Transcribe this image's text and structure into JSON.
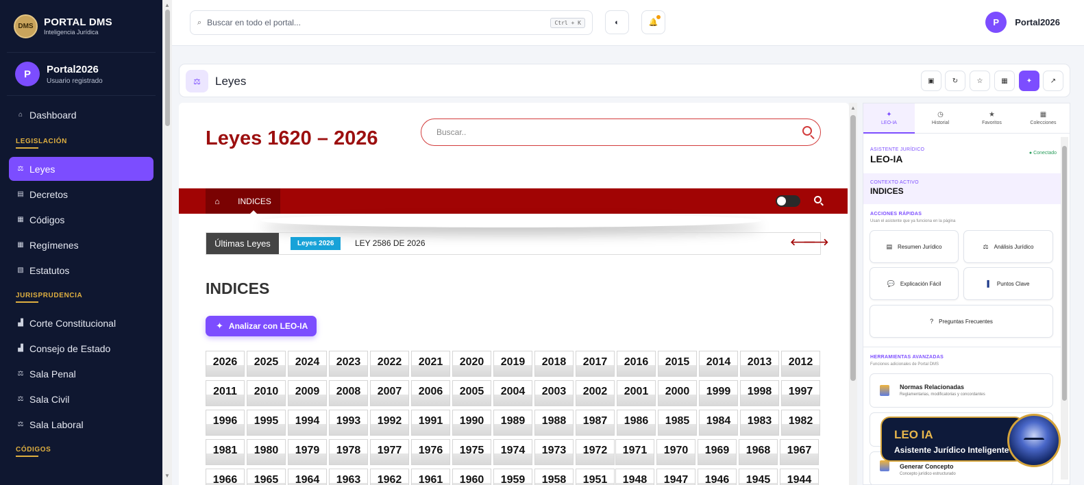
{
  "brand": {
    "logo": "DMS",
    "title": "PORTAL DMS",
    "subtitle": "Inteligencia Jurídica"
  },
  "user": {
    "initial": "P",
    "name": "Portal2026",
    "role": "Usuario registrado"
  },
  "sidebar": {
    "dashboard": "Dashboard",
    "sections": [
      {
        "title": "LEGISLACIÓN",
        "items": [
          "Leyes",
          "Decretos",
          "Códigos",
          "Regímenes",
          "Estatutos"
        ]
      },
      {
        "title": "JURISPRUDENCIA",
        "items": [
          "Corte Constitucional",
          "Consejo de Estado",
          "Sala Penal",
          "Sala Civil",
          "Sala Laboral"
        ]
      },
      {
        "title": "CÓDIGOS",
        "items": []
      }
    ],
    "active": "Leyes"
  },
  "topbar": {
    "search_placeholder": "Buscar en todo el portal...",
    "shortcut": "Ctrl + K",
    "user_initial": "P",
    "user_name": "Portal2026"
  },
  "page": {
    "title": "Leyes"
  },
  "laws": {
    "title": "Leyes 1620 – 2026",
    "search_placeholder": "Buscar..",
    "nav_tab": "INDICES",
    "ticker_label": "Últimas Leyes",
    "ticker_badge": "Leyes 2026",
    "ticker_text": "LEY 2586 DE 2026",
    "indices_title": "INDICES",
    "analyze_button": "Analizar con LEO-IA",
    "years": [
      "2026",
      "2025",
      "2024",
      "2023",
      "2022",
      "2021",
      "2020",
      "2019",
      "2018",
      "2017",
      "2016",
      "2015",
      "2014",
      "2013",
      "2012",
      "2011",
      "2010",
      "2009",
      "2008",
      "2007",
      "2006",
      "2005",
      "2004",
      "2003",
      "2002",
      "2001",
      "2000",
      "1999",
      "1998",
      "1997",
      "1996",
      "1995",
      "1994",
      "1993",
      "1992",
      "1991",
      "1990",
      "1989",
      "1988",
      "1987",
      "1986",
      "1985",
      "1984",
      "1983",
      "1982",
      "1981",
      "1980",
      "1979",
      "1978",
      "1977",
      "1976",
      "1975",
      "1974",
      "1973",
      "1972",
      "1971",
      "1970",
      "1969",
      "1968",
      "1967",
      "1966",
      "1965",
      "1964",
      "1963",
      "1962",
      "1961",
      "1960",
      "1959",
      "1958",
      "1951",
      "1948",
      "1947",
      "1946",
      "1945",
      "1944"
    ]
  },
  "assistant": {
    "tabs": [
      "LEO-IA",
      "Historial",
      "Favoritos",
      "Colecciones"
    ],
    "kicker": "ASISTENTE JURÍDICO",
    "name": "LEO-IA",
    "status": "Conectado",
    "context_kicker": "CONTEXTO ACTIVO",
    "context": "INDICES",
    "quick_title": "ACCIONES RÁPIDAS",
    "quick_sub": "Usan el asistente que ya funciona en la página",
    "quick": [
      "Resumen Jurídico",
      "Análisis Jurídico",
      "Explicación Fácil",
      "Puntos Clave",
      "Preguntas Frecuentes"
    ],
    "tools_title": "HERRAMIENTAS AVANZADAS",
    "tools_sub": "Funciones adicionales de Portal DMS",
    "tools": [
      {
        "title": "Normas Relacionadas",
        "sub": "Reglamentarias, modificatorias y concordantes"
      },
      {
        "title": "Generar Concepto",
        "sub": "Concepto jurídico estructurado"
      }
    ]
  },
  "leo_card": {
    "title": "LEO IA",
    "subtitle": "Asistente Jurídico Inteligente"
  }
}
